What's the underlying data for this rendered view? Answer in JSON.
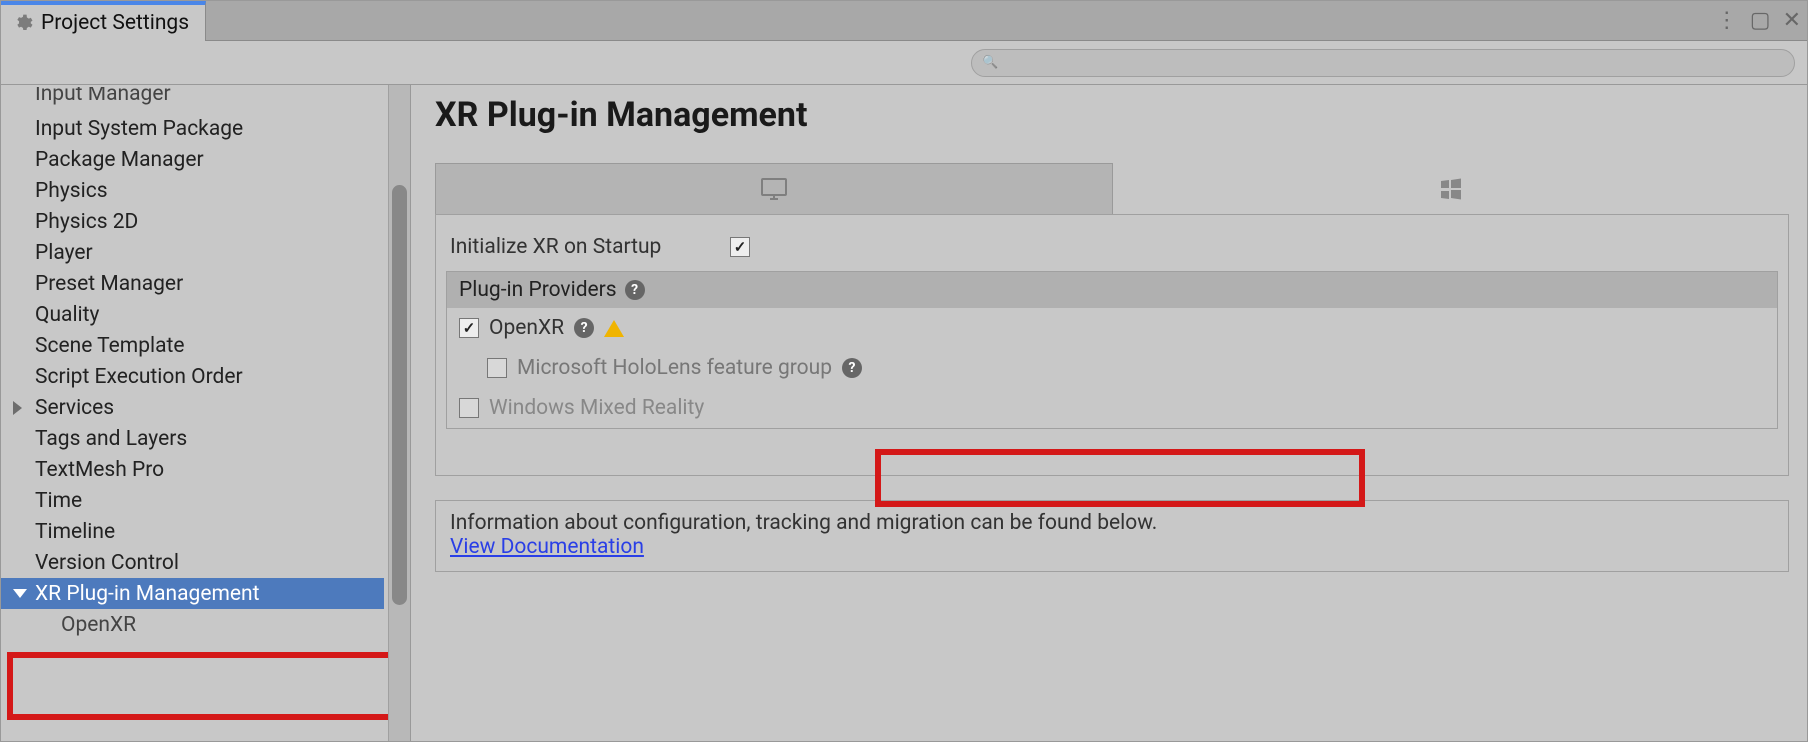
{
  "window": {
    "title": "Project Settings"
  },
  "search": {
    "placeholder": ""
  },
  "sidebar": {
    "items": [
      {
        "label": "Input Manager"
      },
      {
        "label": "Input System Package"
      },
      {
        "label": "Package Manager"
      },
      {
        "label": "Physics"
      },
      {
        "label": "Physics 2D"
      },
      {
        "label": "Player"
      },
      {
        "label": "Preset Manager"
      },
      {
        "label": "Quality"
      },
      {
        "label": "Scene Template"
      },
      {
        "label": "Script Execution Order"
      },
      {
        "label": "Services",
        "expandable": true
      },
      {
        "label": "Tags and Layers"
      },
      {
        "label": "TextMesh Pro"
      },
      {
        "label": "Time"
      },
      {
        "label": "Timeline"
      },
      {
        "label": "Version Control"
      },
      {
        "label": "XR Plug-in Management",
        "selected": true,
        "expanded": true
      },
      {
        "label": "OpenXR",
        "child": true
      }
    ]
  },
  "main": {
    "title": "XR Plug-in Management",
    "init_label": "Initialize XR on Startup",
    "init_checked": true,
    "providers_header": "Plug-in Providers",
    "providers": {
      "openxr": {
        "label": "OpenXR",
        "checked": true,
        "warn": true
      },
      "hololens": {
        "label": "Microsoft HoloLens feature group",
        "checked": false,
        "disabled": true
      },
      "wmr": {
        "label": "Windows Mixed Reality",
        "checked": false,
        "disabled": true
      }
    },
    "info_text": "Information about configuration, tracking and migration can be found below.",
    "doc_link_label": "View Documentation"
  }
}
